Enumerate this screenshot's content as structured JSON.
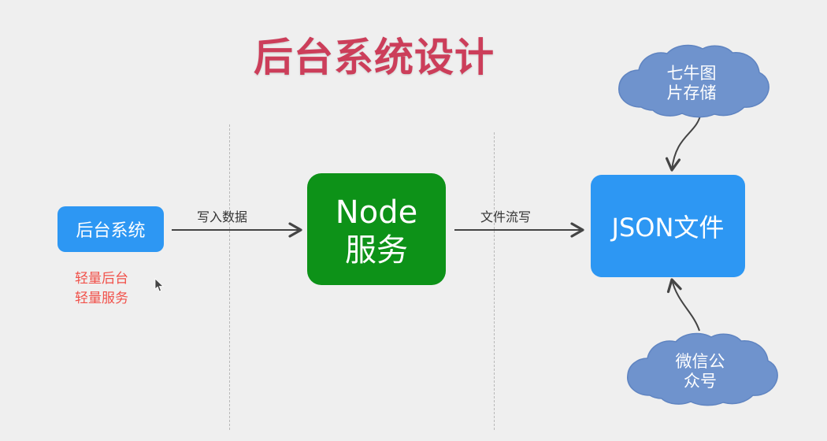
{
  "title": "后台系统设计",
  "nodes": {
    "admin": {
      "label": "后台系统",
      "notes": [
        "轻量后台",
        "轻量服务"
      ]
    },
    "node_service": {
      "line1": "Node",
      "line2": "服务"
    },
    "json_file": {
      "label": "JSON文件"
    },
    "qiniu": {
      "line1": "七牛图",
      "line2": "片存储"
    },
    "wechat": {
      "line1": "微信公",
      "line2": "众号"
    }
  },
  "edges": {
    "write_data": "写入数据",
    "file_stream": "文件流写"
  },
  "colors": {
    "title": "#cc3e5a",
    "blue_box": "#2d97f3",
    "green_box": "#0d9218",
    "cloud": "#6f93cd",
    "note": "#f1514a",
    "line": "#444444",
    "divider": "#b9b9b9"
  }
}
